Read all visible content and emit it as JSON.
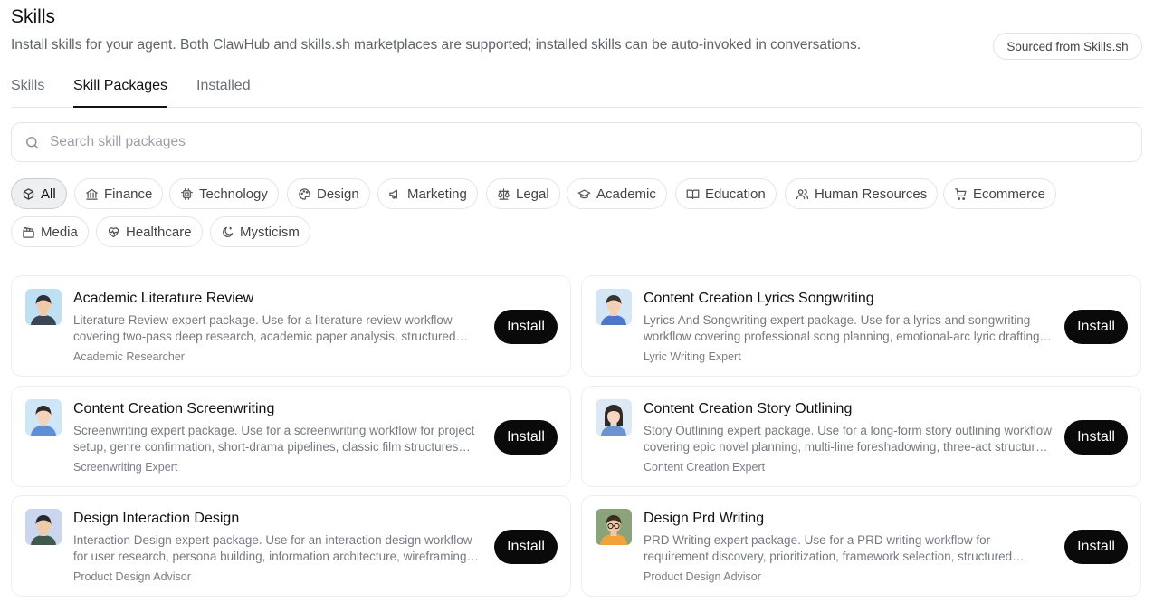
{
  "header": {
    "title": "Skills",
    "subtitle": "Install skills for your agent. Both ClawHub and skills.sh marketplaces are supported; installed skills can be auto-invoked in conversations.",
    "source_badge": "Sourced from Skills.sh"
  },
  "tabs": [
    {
      "label": "Skills",
      "active": false
    },
    {
      "label": "Skill Packages",
      "active": true
    },
    {
      "label": "Installed",
      "active": false
    }
  ],
  "search": {
    "placeholder": "Search skill packages",
    "value": ""
  },
  "categories": [
    {
      "label": "All",
      "icon": "package-icon",
      "active": true
    },
    {
      "label": "Finance",
      "icon": "bank-icon"
    },
    {
      "label": "Technology",
      "icon": "cpu-icon"
    },
    {
      "label": "Design",
      "icon": "palette-icon"
    },
    {
      "label": "Marketing",
      "icon": "megaphone-icon"
    },
    {
      "label": "Legal",
      "icon": "scale-icon"
    },
    {
      "label": "Academic",
      "icon": "graduation-cap-icon"
    },
    {
      "label": "Education",
      "icon": "book-open-icon"
    },
    {
      "label": "Human Resources",
      "icon": "users-icon"
    },
    {
      "label": "Ecommerce",
      "icon": "shopping-cart-icon"
    },
    {
      "label": "Media",
      "icon": "clapperboard-icon"
    },
    {
      "label": "Healthcare",
      "icon": "heart-pulse-icon"
    },
    {
      "label": "Mysticism",
      "icon": "moon-star-icon"
    }
  ],
  "install_label": "Install",
  "packages": [
    {
      "title": "Academic Literature Review",
      "description": "Literature Review expert package. Use for a literature review workflow covering two-pass deep research, academic paper analysis, structured synthesis and citation formatting.",
      "author": "Academic Researcher",
      "avatar_colors": {
        "bg": "#bfe0f3",
        "hair": "#2b2f38",
        "skin": "#f2c9a8",
        "shirt": "#3b4654"
      }
    },
    {
      "title": "Content Creation Lyrics Songwriting",
      "description": "Lyrics And Songwriting expert package. Use for a lyrics and songwriting workflow covering professional song planning, emotional-arc lyric drafting and rhyme refinement.",
      "author": "Lyric Writing Expert",
      "avatar_colors": {
        "bg": "#d4e6f6",
        "hair": "#3a3430",
        "skin": "#f3d0b4",
        "shirt": "#4b78c8"
      }
    },
    {
      "title": "Content Creation Screenwriting",
      "description": "Screenwriting expert package. Use for a screenwriting workflow for project setup, genre confirmation, short-drama pipelines, classic film structures and scene breakdowns.",
      "author": "Screenwriting Expert",
      "avatar_colors": {
        "bg": "#cfe6f7",
        "hair": "#2c2a2a",
        "skin": "#f4d3b8",
        "shirt": "#5b8fd6"
      }
    },
    {
      "title": "Content Creation Story Outlining",
      "description": "Story Outlining expert package. Use for a long-form story outlining workflow covering epic novel planning, multi-line foreshadowing, three-act structure and chapter plans.",
      "author": "Content Creation Expert",
      "avatar_colors": {
        "bg": "#dce9f5",
        "hair": "#2f2a28",
        "skin": "#f5d6c0",
        "shirt": "#6b93cf"
      }
    },
    {
      "title": "Design Interaction Design",
      "description": "Interaction Design expert package. Use for an interaction design workflow for user research, persona building, information architecture, wireframing and usability testing.",
      "author": "Product Design Advisor",
      "avatar_colors": {
        "bg": "#c9d6ee",
        "hair": "#262a30",
        "skin": "#efcaa9",
        "shirt": "#3f5a4c"
      }
    },
    {
      "title": "Design Prd Writing",
      "description": "PRD Writing expert package. Use for a PRD writing workflow for requirement discovery, prioritization, framework selection, structured documentation and review.",
      "author": "Product Design Advisor",
      "avatar_colors": {
        "bg": "#8aa37a",
        "hair": "#3a2e24",
        "skin": "#f1c8a2",
        "shirt": "#f2a23a"
      }
    }
  ]
}
